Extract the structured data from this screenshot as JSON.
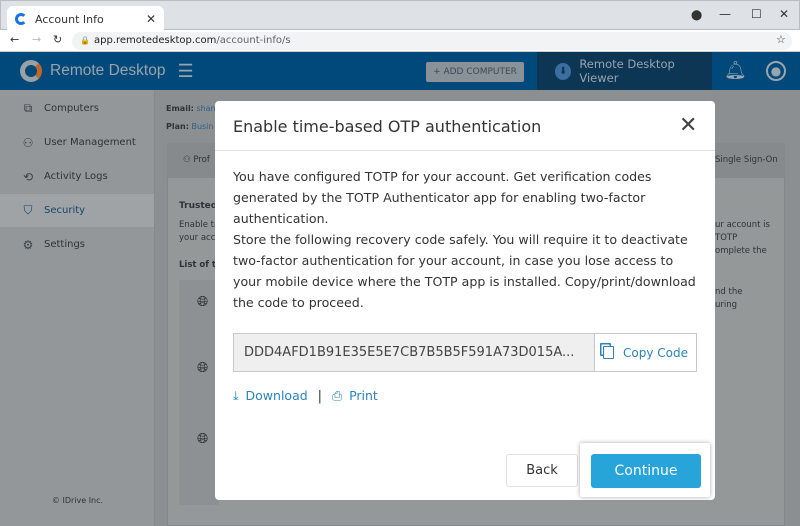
{
  "browser": {
    "tab_title": "Account Info",
    "url_host": "app.remotedesktop.com",
    "url_path": "/account-info/s"
  },
  "header": {
    "brand": "Remote Desktop",
    "add_computer": "+ ADD COMPUTER",
    "viewer": "Remote Desktop Viewer"
  },
  "sidebar": {
    "items": [
      {
        "label": "Computers",
        "icon": "computers-icon"
      },
      {
        "label": "User Management",
        "icon": "user-icon"
      },
      {
        "label": "Activity Logs",
        "icon": "history-icon"
      },
      {
        "label": "Security",
        "icon": "shield-icon",
        "active": true
      },
      {
        "label": "Settings",
        "icon": "gear-icon"
      }
    ],
    "copyright": "© IDrive Inc."
  },
  "account": {
    "email_label": "Email:",
    "email_value": "shan",
    "plan_label": "Plan:",
    "plan_value": "Busin"
  },
  "background": {
    "tab_profile": "Prof",
    "tab_sso": "Single Sign-On",
    "section_title": "Trusted",
    "desc_line1": "Enable tr",
    "desc_line2": "your acc",
    "list_title": "List of tr",
    "right_line1": "ur account is",
    "right_line2": "TOTP",
    "right_line3": "omplete the",
    "right_line4": "nd the",
    "right_line5": "uring"
  },
  "modal": {
    "title": "Enable time-based OTP authentication",
    "para1": "You have configured TOTP for your account. Get verification codes generated by the TOTP Authenticator app for enabling two-factor authentication.",
    "para2": "Store the following recovery code safely. You will require it to deactivate two-factor authentication for your account, in case you lose access to your mobile device where the TOTP app is installed. Copy/print/download the code to proceed.",
    "code": "DDD4AFD1B91E35E5E7CB7B5B5F591A73D015A...",
    "copy_code": "Copy Code",
    "download": "Download",
    "separator": "|",
    "print": "Print",
    "back": "Back",
    "continue": "Continue"
  },
  "colors": {
    "header": "#00497a",
    "accent": "#27a4da",
    "link": "#2a84b8"
  }
}
